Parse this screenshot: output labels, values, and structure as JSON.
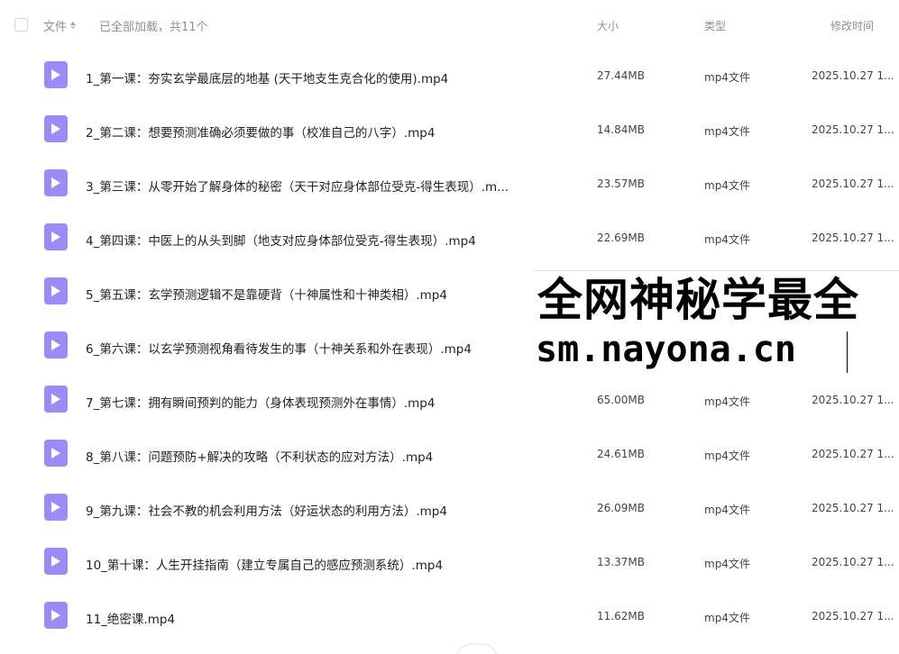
{
  "header": {
    "name_label": "文件",
    "loaded_status": "已全部加载，共11个",
    "size_label": "大小",
    "type_label": "类型",
    "time_label": "修改时间"
  },
  "files": [
    {
      "name": "1_第一课：夯实玄学最底层的地基 (天干地支生克合化的使用).mp4",
      "size": "27.44MB",
      "type": "mp4文件",
      "time": "2025.10.27 1..."
    },
    {
      "name": "2_第二课：想要预测准确必须要做的事（校准自己的八字）.mp4",
      "size": "14.84MB",
      "type": "mp4文件",
      "time": "2025.10.27 1..."
    },
    {
      "name": "3_第三课：从零开始了解身体的秘密（天干对应身体部位受克-得生表现）.m...",
      "size": "23.57MB",
      "type": "mp4文件",
      "time": "2025.10.27 1..."
    },
    {
      "name": "4_第四课：中医上的从头到脚（地支对应身体部位受克-得生表现）.mp4",
      "size": "22.69MB",
      "type": "mp4文件",
      "time": "2025.10.27 1..."
    },
    {
      "name": "5_第五课：玄学预测逻辑不是靠硬背（十神属性和十神类相）.mp4",
      "size": "",
      "type": "",
      "time": ""
    },
    {
      "name": "6_第六课：以玄学预测视角看待发生的事（十神关系和外在表现）.mp4",
      "size": "",
      "type": "",
      "time": ""
    },
    {
      "name": "7_第七课：拥有瞬间预判的能力（身体表现预测外在事情）.mp4",
      "size": "65.00MB",
      "type": "mp4文件",
      "time": "2025.10.27 1..."
    },
    {
      "name": "8_第八课：问题预防+解决的攻略（不利状态的应对方法）.mp4",
      "size": "24.61MB",
      "type": "mp4文件",
      "time": "2025.10.27 1..."
    },
    {
      "name": "9_第九课：社会不教的机会利用方法（好运状态的利用方法）.mp4",
      "size": "26.09MB",
      "type": "mp4文件",
      "time": "2025.10.27 1..."
    },
    {
      "name": "10_第十课：人生开挂指南（建立专属自己的感应预测系统）.mp4",
      "size": "13.37MB",
      "type": "mp4文件",
      "time": "2025.10.27 1..."
    },
    {
      "name": "11_绝密课.mp4",
      "size": "11.62MB",
      "type": "mp4文件",
      "time": "2025.10.27 1..."
    }
  ],
  "watermark": {
    "line1": "全网神秘学最全",
    "line2": "sm.nayona.cn"
  },
  "colors": {
    "icon_bg": "#9b8cf5",
    "header_text": "#8a8f99"
  },
  "icons": {
    "file": "video-file-icon",
    "sort": "sort-icon",
    "checkbox": "checkbox-icon"
  }
}
